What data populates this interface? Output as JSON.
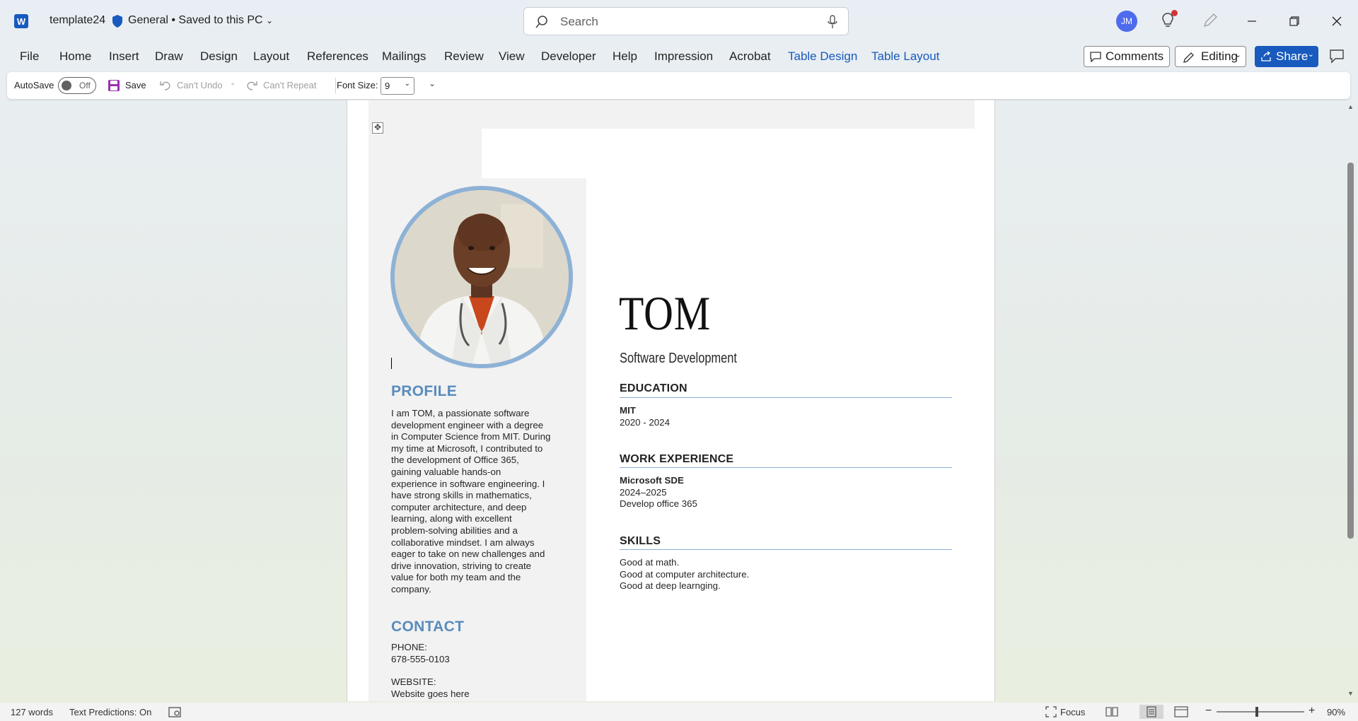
{
  "titlebar": {
    "app_logo": "W",
    "doc_name": "template24",
    "sensitivity": "General",
    "save_status": "• Saved to this PC",
    "search_placeholder": "Search",
    "avatar_initials": "JM"
  },
  "menu": [
    "File",
    "Home",
    "Insert",
    "Draw",
    "Design",
    "Layout",
    "References",
    "Mailings",
    "Review",
    "View",
    "Developer",
    "Help",
    "Impression",
    "Acrobat",
    "Table Design",
    "Table Layout"
  ],
  "actions": {
    "comments": "Comments",
    "editing": "Editing",
    "share": "Share"
  },
  "qat": {
    "autosave_label": "AutoSave",
    "autosave_state": "Off",
    "save": "Save",
    "undo": "Can't Undo",
    "repeat": "Can't Repeat",
    "font_size_label": "Font Size:",
    "font_size_value": "9"
  },
  "resume": {
    "name": "TOM",
    "role": "Software Development",
    "profile_heading": "PROFILE",
    "profile_lines": [
      "I am TOM, a passionate software",
      "development engineer with a degree",
      "in Computer Science from MIT. During",
      "my time at Microsoft, I contributed to",
      "the development of Office 365,",
      "gaining valuable hands-on",
      "experience in software engineering. I",
      "have strong skills in mathematics,",
      "computer architecture, and deep",
      "learning, along with excellent",
      "problem-solving abilities and a",
      "collaborative mindset. I am always",
      "eager to take on new challenges and",
      "drive innovation, striving to create",
      "value for both my team and the",
      "company."
    ],
    "contact_heading": "CONTACT",
    "phone_label": "PHONE:",
    "phone": "678-555-0103",
    "website_label": "WEBSITE:",
    "website": "Website goes here",
    "education_heading": "EDUCATION",
    "edu_school": "MIT",
    "edu_years": "2020 - 2024",
    "work_heading": "WORK EXPERIENCE",
    "work_title": "Microsoft SDE",
    "work_years": "2024–2025",
    "work_desc": "Develop office 365",
    "skills_heading": "SKILLS",
    "skills": [
      "Good at math.",
      "Good at computer architecture.",
      "Good at deep learnging."
    ]
  },
  "status": {
    "words": "127 words",
    "predictions": "Text Predictions: On",
    "focus": "Focus",
    "zoom": "90%"
  },
  "colors": {
    "accent_blue": "#185abd",
    "resume_blue": "#5a8bbd",
    "photo_ring": "#8eb2d6"
  }
}
